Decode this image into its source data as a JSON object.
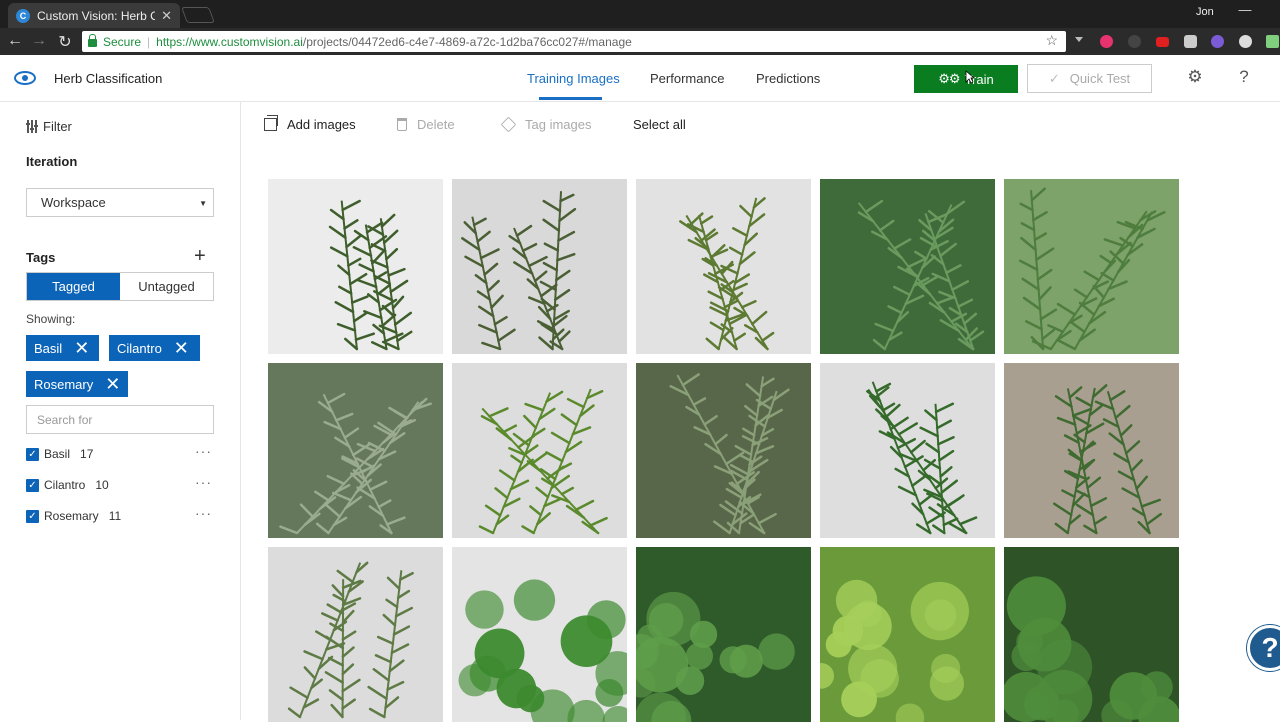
{
  "browser": {
    "tab_title": "Custom Vision: Herb Clas",
    "tab_favicon_letter": "C",
    "user": "Jon",
    "secure_label": "Secure",
    "url_host": "https://www.customvision.ai",
    "url_path": "/projects/04472ed6-c4e7-4869-a72c-1d2ba76cc027#/manage"
  },
  "app": {
    "project_name": "Herb Classification",
    "nav": [
      "Training Images",
      "Performance",
      "Predictions"
    ],
    "active_nav": "Training Images",
    "train_label": "Train",
    "quicktest_label": "Quick Test",
    "brand_color": "#0b64b8",
    "train_color": "#0a7d20"
  },
  "sidebar": {
    "filter_label": "Filter",
    "iteration_label": "Iteration",
    "iteration_value": "Workspace",
    "tags_label": "Tags",
    "toggle": [
      "Tagged",
      "Untagged"
    ],
    "showing_label": "Showing:",
    "chips": [
      "Basil",
      "Cilantro",
      "Rosemary"
    ],
    "search_placeholder": "Search for",
    "tags": [
      {
        "name": "Basil",
        "count": "17",
        "checked": true
      },
      {
        "name": "Cilantro",
        "count": "10",
        "checked": true
      },
      {
        "name": "Rosemary",
        "count": "11",
        "checked": true
      }
    ]
  },
  "toolbar": {
    "add_images": "Add images",
    "delete": "Delete",
    "tag_images": "Tag images",
    "select_all": "Select all"
  },
  "images": [
    {
      "herb": "rosemary",
      "bg": "#ececec",
      "leaf": "#3e5e2b"
    },
    {
      "herb": "rosemary",
      "bg": "#d9d9d9",
      "leaf": "#4a5f34"
    },
    {
      "herb": "rosemary",
      "bg": "#e2e2e2",
      "leaf": "#5c7a32"
    },
    {
      "herb": "rosemary",
      "bg": "#3f6b3a",
      "leaf": "#6b9a5e"
    },
    {
      "herb": "rosemary",
      "bg": "#7da36a",
      "leaf": "#4e7d3e"
    },
    {
      "herb": "rosemary",
      "bg": "#65785c",
      "leaf": "#9aab8e"
    },
    {
      "herb": "rosemary",
      "bg": "#dddddd",
      "leaf": "#5a8a2c"
    },
    {
      "herb": "rosemary",
      "bg": "#58664a",
      "leaf": "#8aa078"
    },
    {
      "herb": "rosemary",
      "bg": "#dedede",
      "leaf": "#356b2a"
    },
    {
      "herb": "rosemary",
      "bg": "#a89f90",
      "leaf": "#3f6a30"
    },
    {
      "herb": "rosemary",
      "bg": "#dcdcdc",
      "leaf": "#5e7a45"
    },
    {
      "herb": "cilantro",
      "bg": "#e4e4e4",
      "leaf": "#3c8a2e"
    },
    {
      "herb": "cilantro",
      "bg": "#2f5a2a",
      "leaf": "#5f9e4a"
    },
    {
      "herb": "cilantro",
      "bg": "#6a9a3a",
      "leaf": "#a6cf5a"
    },
    {
      "herb": "cilantro",
      "bg": "#2d5327",
      "leaf": "#4f8d3c"
    }
  ],
  "help_bubble": "?"
}
